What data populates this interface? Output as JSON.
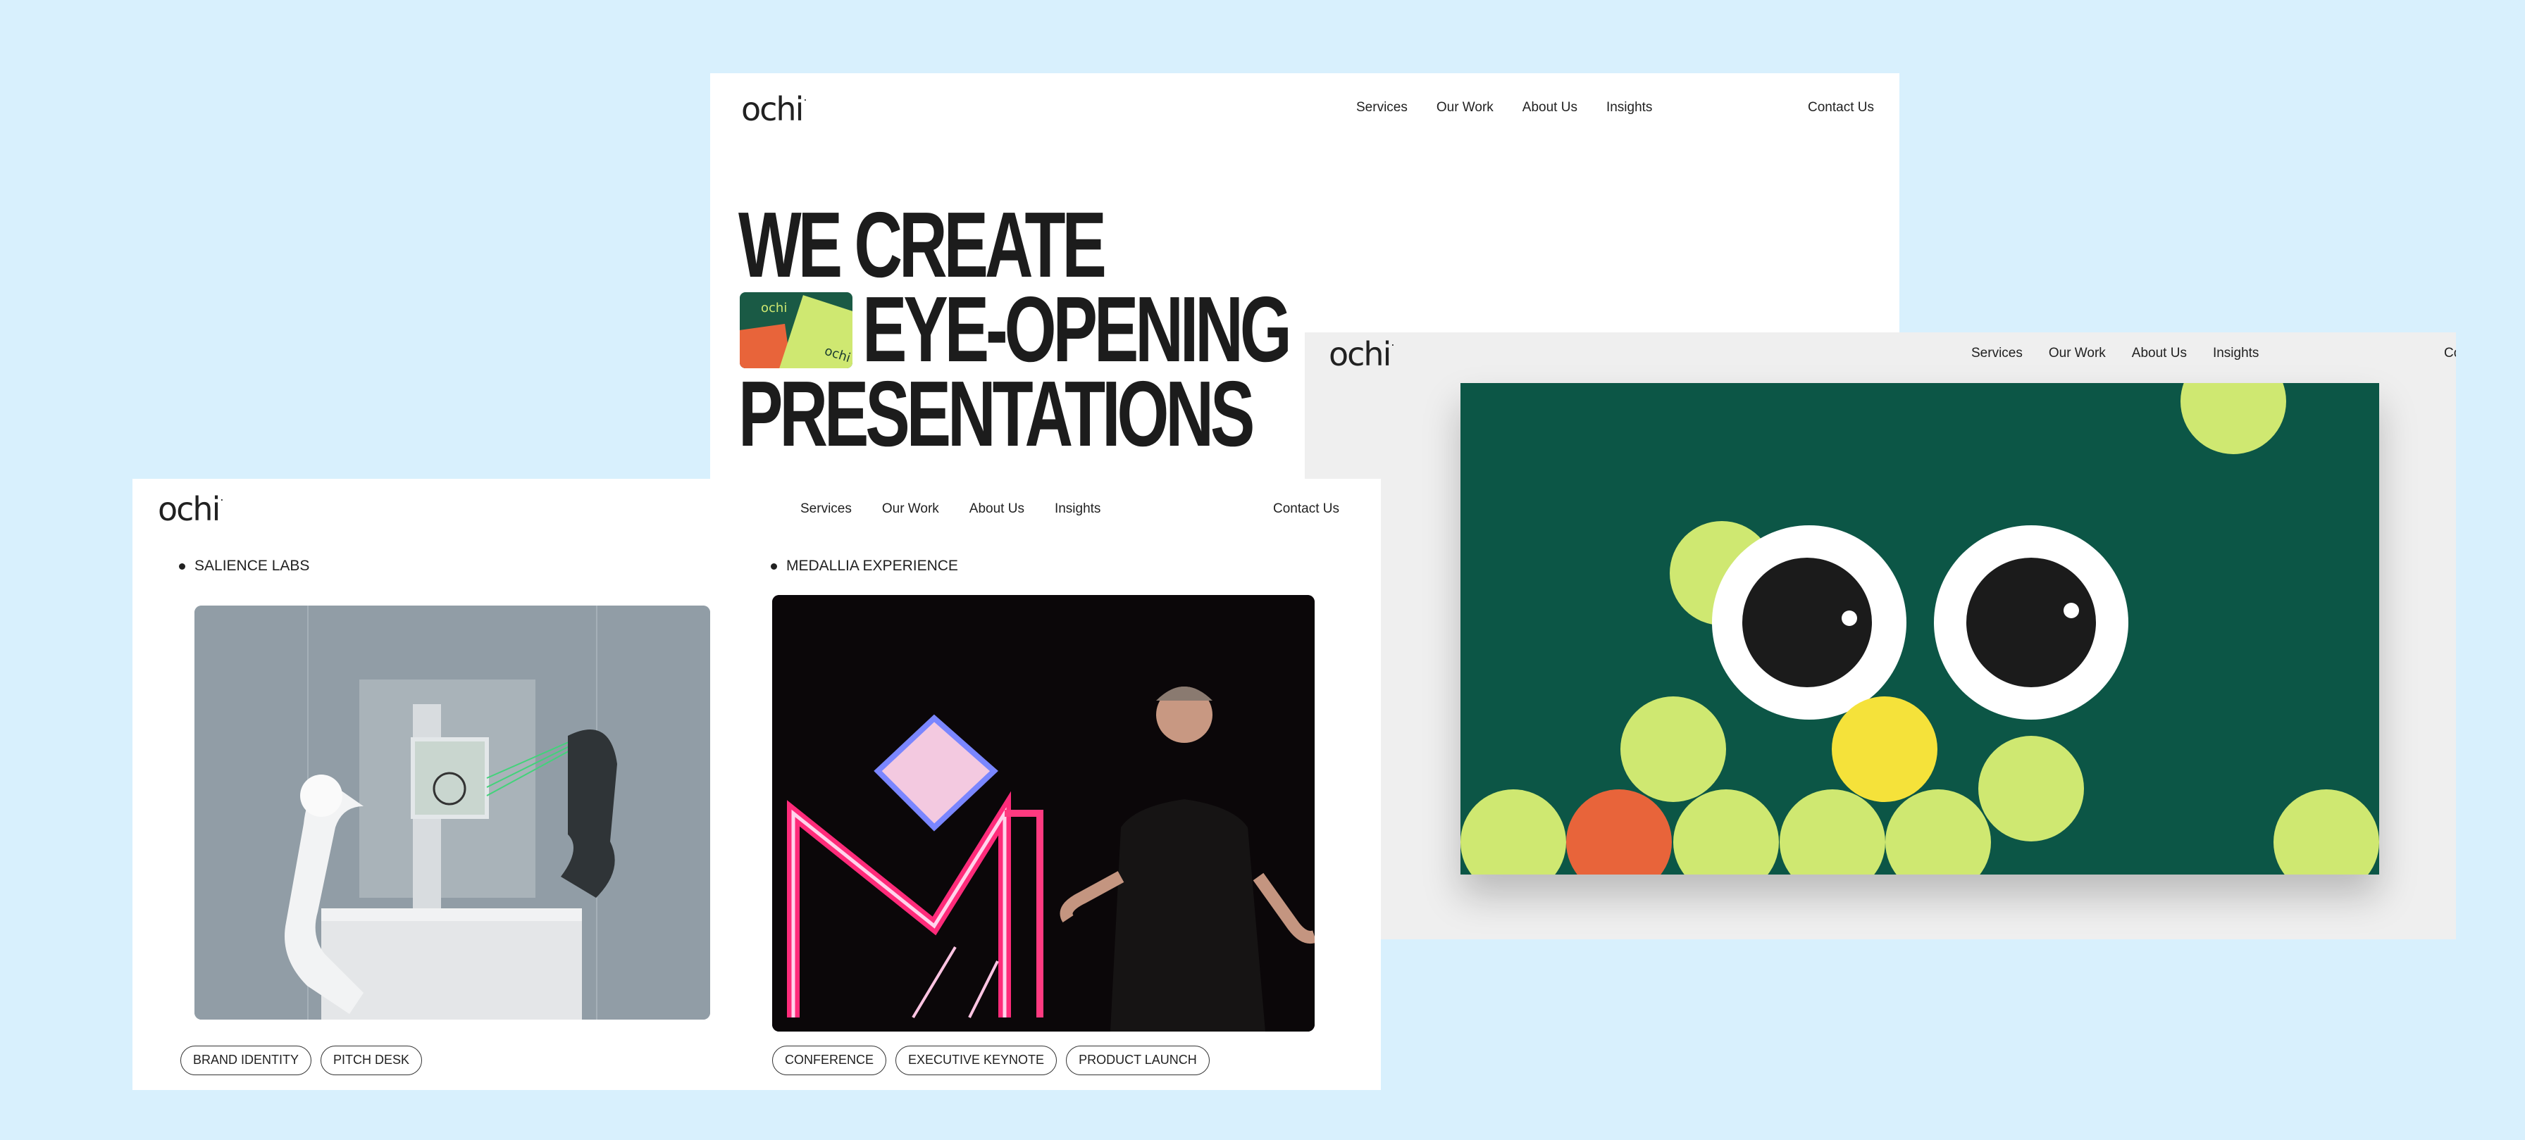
{
  "brand": {
    "logo": "ochi"
  },
  "nav": {
    "items": [
      "Services",
      "Our Work",
      "About Us",
      "Insights"
    ],
    "contact": "Contact Us",
    "contact_cut": "Co"
  },
  "hero": {
    "line1": "WE CREATE",
    "line2": "EYE-OPENING",
    "line3": "PRESENTATIONS",
    "thumb_logo_a": "ochi",
    "thumb_logo_b": "ochi"
  },
  "projects": [
    {
      "title": "SALIENCE LABS",
      "tags": [
        "BRAND IDENTITY",
        "PITCH DESK"
      ]
    },
    {
      "title": "MEDALLIA EXPERIENCE",
      "tags": [
        "CONFERENCE",
        "EXECUTIVE KEYNOTE",
        "PRODUCT LAUNCH"
      ]
    }
  ],
  "colors": {
    "page_bg": "#d8f0fd",
    "illustration_bg": "#0c5646",
    "lime": "#cfe871",
    "orange": "#e8643a",
    "yellow": "#f5e23a"
  }
}
